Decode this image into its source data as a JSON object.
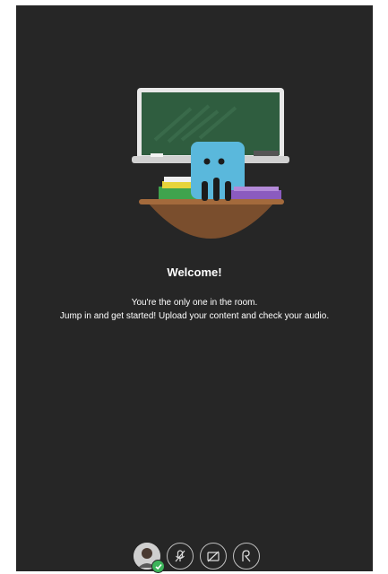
{
  "welcome": {
    "title": "Welcome!",
    "line1": "You're the only one in the room.",
    "line2": "Jump in and get started! Upload your content and check your audio."
  },
  "controls": [
    {
      "icon": "avatar",
      "status": "connected"
    },
    {
      "icon": "microphone-muted-icon"
    },
    {
      "icon": "camera-off-icon"
    },
    {
      "icon": "share-content-icon"
    }
  ],
  "colors": {
    "background": "#262626",
    "text": "#ffffff",
    "accent_green": "#3cb45a",
    "chalkboard": "#2f5d3f",
    "robot_blue": "#5ab8dc",
    "desk_brown": "#7a4e2d"
  }
}
